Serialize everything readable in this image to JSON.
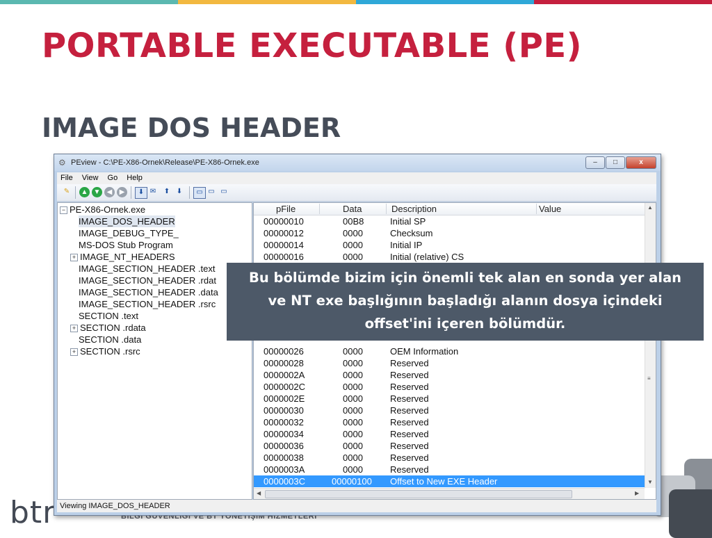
{
  "slide": {
    "title": "PORTABLE EXECUTABLE (PE)",
    "subtitle": "IMAGE DOS HEADER",
    "top_strip_colors": [
      "#5bb8b0",
      "#f2b840",
      "#2fa8d8",
      "#c5203e"
    ],
    "title_color": "#c5203e",
    "subtitle_color": "#454c58"
  },
  "window": {
    "title": "PEview - C:\\PE-X86-Ornek\\Release\\PE-X86-Ornek.exe",
    "controls": {
      "minimize": "–",
      "maximize": "□",
      "close": "x"
    }
  },
  "menu": [
    "File",
    "View",
    "Go",
    "Help"
  ],
  "toolbar_icons": [
    "open-icon",
    "back-icon",
    "forward-icon",
    "nav-back-icon",
    "nav-forward-icon",
    "view-byte-icon",
    "view-word-icon",
    "view-dword-icon",
    "view-qword-icon",
    "list-view-icon",
    "detail-view-icon",
    "small-view-icon"
  ],
  "tree": {
    "root": "PE-X86-Ornek.exe",
    "items": [
      {
        "label": "IMAGE_DOS_HEADER",
        "expandable": false,
        "selected": true
      },
      {
        "label": "IMAGE_DEBUG_TYPE_",
        "expandable": false
      },
      {
        "label": "MS-DOS Stub Program",
        "expandable": false
      },
      {
        "label": "IMAGE_NT_HEADERS",
        "expandable": true
      },
      {
        "label": "IMAGE_SECTION_HEADER .text",
        "expandable": false
      },
      {
        "label": "IMAGE_SECTION_HEADER .rdat",
        "expandable": false
      },
      {
        "label": "IMAGE_SECTION_HEADER .data",
        "expandable": false
      },
      {
        "label": "IMAGE_SECTION_HEADER .rsrc",
        "expandable": false
      },
      {
        "label": "SECTION .text",
        "expandable": false
      },
      {
        "label": "SECTION .rdata",
        "expandable": true
      },
      {
        "label": "SECTION .data",
        "expandable": false
      },
      {
        "label": "SECTION .rsrc",
        "expandable": true
      }
    ]
  },
  "list": {
    "columns": [
      "pFile",
      "Data",
      "Description",
      "Value"
    ],
    "rows": [
      {
        "pfile": "00000010",
        "data": "00B8",
        "desc": "Initial SP"
      },
      {
        "pfile": "00000012",
        "data": "0000",
        "desc": "Checksum"
      },
      {
        "pfile": "00000014",
        "data": "0000",
        "desc": "Initial IP"
      },
      {
        "pfile": "00000016",
        "data": "0000",
        "desc": "Initial (relative) CS"
      },
      {
        "pfile": "00000026",
        "data": "0000",
        "desc": "OEM Information"
      },
      {
        "pfile": "00000028",
        "data": "0000",
        "desc": "Reserved"
      },
      {
        "pfile": "0000002A",
        "data": "0000",
        "desc": "Reserved"
      },
      {
        "pfile": "0000002C",
        "data": "0000",
        "desc": "Reserved"
      },
      {
        "pfile": "0000002E",
        "data": "0000",
        "desc": "Reserved"
      },
      {
        "pfile": "00000030",
        "data": "0000",
        "desc": "Reserved"
      },
      {
        "pfile": "00000032",
        "data": "0000",
        "desc": "Reserved"
      },
      {
        "pfile": "00000034",
        "data": "0000",
        "desc": "Reserved"
      },
      {
        "pfile": "00000036",
        "data": "0000",
        "desc": "Reserved"
      },
      {
        "pfile": "00000038",
        "data": "0000",
        "desc": "Reserved"
      },
      {
        "pfile": "0000003A",
        "data": "0000",
        "desc": "Reserved"
      },
      {
        "pfile": "0000003C",
        "data": "00000100",
        "desc": "Offset to New EXE Header",
        "selected": true
      }
    ]
  },
  "status": "Viewing IMAGE_DOS_HEADER",
  "callout": {
    "line1": "Bu bölümde bizim için önemli tek alan en sonda yer alan",
    "line2": "ve NT exe başlığının başladığı alanın dosya içindeki",
    "line3": "offset'ini içeren bölümdür."
  },
  "footer": {
    "logo": "btr",
    "tagline": "BİLGİ GÜVENLİĞİ VE BT YÖNETİŞİM HİZMETLERİ"
  }
}
